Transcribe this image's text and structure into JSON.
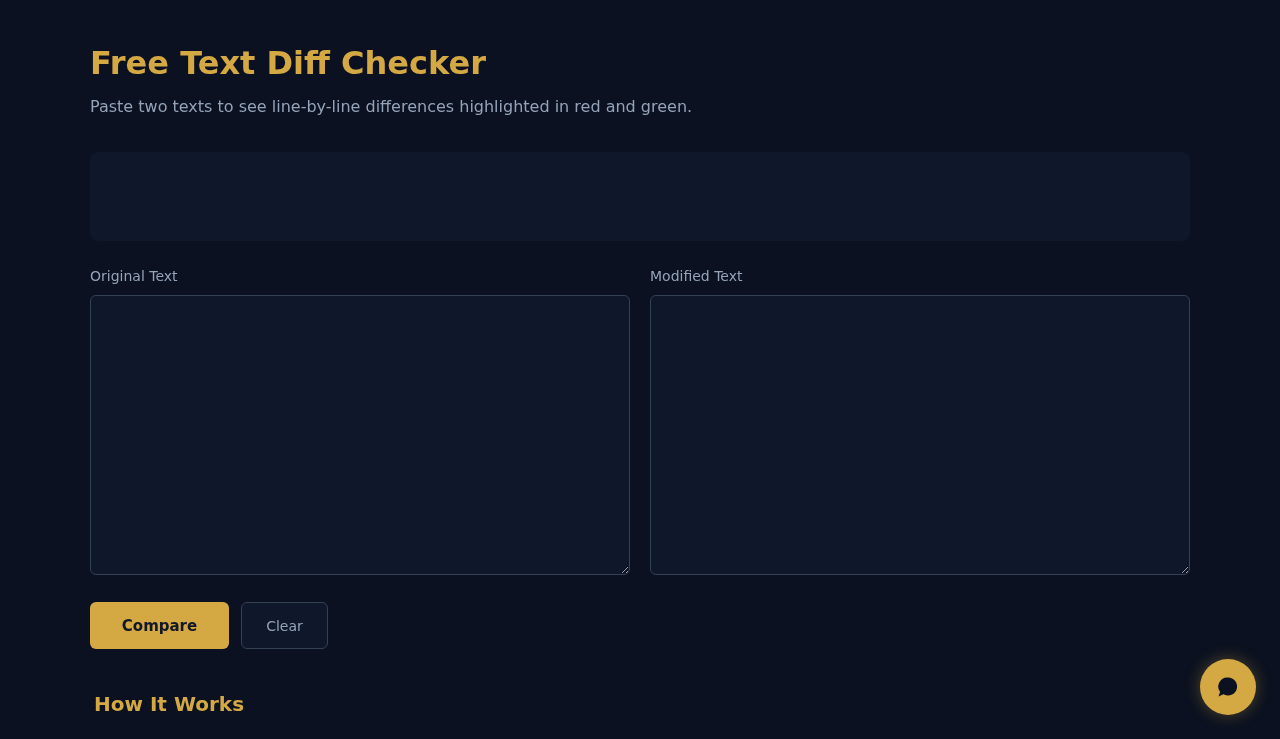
{
  "header": {
    "title": "Free Text Diff Checker",
    "subtitle": "Paste two texts to see line-by-line differences highlighted in red and green."
  },
  "editors": [
    {
      "label": "Original Text"
    },
    {
      "label": "Modified Text"
    }
  ],
  "buttons": [
    {
      "label": "Compare",
      "kind": "primary"
    },
    {
      "label": "Clear",
      "kind": "secondary"
    }
  ],
  "how_it_works": {
    "heading": "How It Works"
  }
}
